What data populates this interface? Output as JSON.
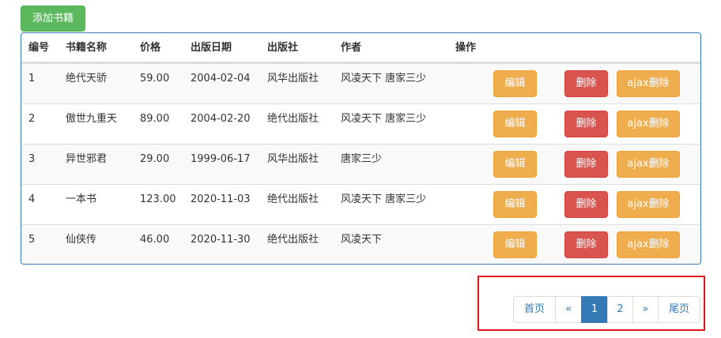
{
  "toolbar": {
    "add_label": "添加书籍"
  },
  "table": {
    "headers": [
      "编号",
      "书籍名称",
      "价格",
      "出版日期",
      "出版社",
      "作者",
      "操作"
    ],
    "rows": [
      {
        "id": "1",
        "name": "绝代天骄",
        "price": "59.00",
        "date": "2004-02-04",
        "publisher": "风华出版社",
        "author": "风凌天下 唐家三少"
      },
      {
        "id": "2",
        "name": "傲世九重天",
        "price": "89.00",
        "date": "2004-02-20",
        "publisher": "绝代出版社",
        "author": "风凌天下 唐家三少"
      },
      {
        "id": "3",
        "name": "异世邪君",
        "price": "29.00",
        "date": "1999-06-17",
        "publisher": "风华出版社",
        "author": "唐家三少"
      },
      {
        "id": "4",
        "name": "一本书",
        "price": "123.00",
        "date": "2020-11-03",
        "publisher": "绝代出版社",
        "author": "风凌天下 唐家三少"
      },
      {
        "id": "5",
        "name": "仙侠传",
        "price": "46.00",
        "date": "2020-11-30",
        "publisher": "绝代出版社",
        "author": "风凌天下"
      }
    ],
    "actions": {
      "edit": "编辑",
      "delete": "删除",
      "ajax_delete": "ajax删除"
    }
  },
  "pagination": {
    "first": "首页",
    "prev": "«",
    "pages": [
      "1",
      "2"
    ],
    "current": "1",
    "next": "»",
    "last": "尾页"
  },
  "colors": {
    "success": "#5cb85c",
    "warning": "#f0ad4e",
    "danger": "#d9534f",
    "primary": "#337ab7",
    "highlight": "#e3171a"
  }
}
